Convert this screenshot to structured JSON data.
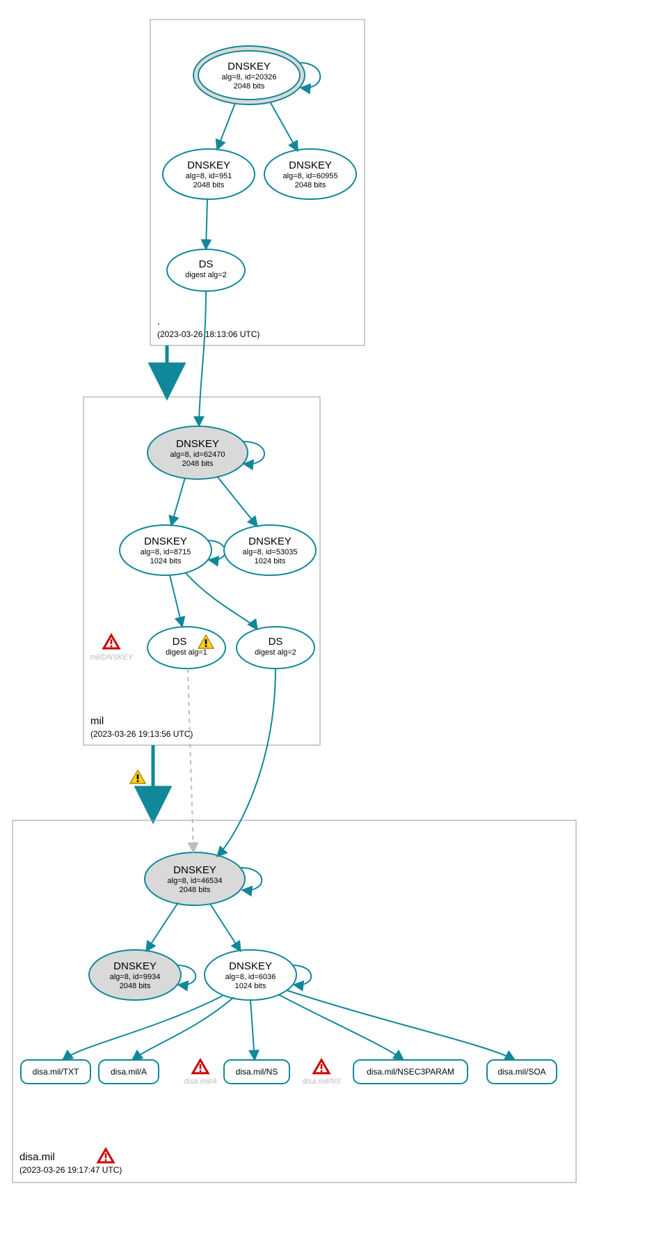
{
  "colors": {
    "stroke": "#118899",
    "ksk_fill": "#d9d9d9"
  },
  "zones": {
    "root": {
      "label": ".",
      "timestamp": "(2023-03-26 18:13:06 UTC)"
    },
    "mil": {
      "label": "mil",
      "timestamp": "(2023-03-26 19:13:56 UTC)"
    },
    "disa": {
      "label": "disa.mil",
      "timestamp": "(2023-03-26 19:17:47 UTC)"
    }
  },
  "nodes": {
    "root_ksk": {
      "title": "DNSKEY",
      "line2": "alg=8, id=20326",
      "line3": "2048 bits"
    },
    "root_zsk1": {
      "title": "DNSKEY",
      "line2": "alg=8, id=951",
      "line3": "2048 bits"
    },
    "root_zsk2": {
      "title": "DNSKEY",
      "line2": "alg=8, id=60955",
      "line3": "2048 bits"
    },
    "root_ds": {
      "title": "DS",
      "line2": "digest alg=2"
    },
    "mil_ksk": {
      "title": "DNSKEY",
      "line2": "alg=8, id=62470",
      "line3": "2048 bits"
    },
    "mil_zsk1": {
      "title": "DNSKEY",
      "line2": "alg=8, id=8715",
      "line3": "1024 bits"
    },
    "mil_zsk2": {
      "title": "DNSKEY",
      "line2": "alg=8, id=53035",
      "line3": "1024 bits"
    },
    "mil_ds1": {
      "title": "DS",
      "line2": "digest alg=1"
    },
    "mil_ds2": {
      "title": "DS",
      "line2": "digest alg=2"
    },
    "mil_err": {
      "label": "mil/DNSKEY"
    },
    "disa_ksk": {
      "title": "DNSKEY",
      "line2": "alg=8, id=46534",
      "line3": "2048 bits"
    },
    "disa_key2": {
      "title": "DNSKEY",
      "line2": "alg=8, id=9934",
      "line3": "2048 bits"
    },
    "disa_key3": {
      "title": "DNSKEY",
      "line2": "alg=8, id=6036",
      "line3": "1024 bits"
    },
    "rr_txt": {
      "label": "disa.mil/TXT"
    },
    "rr_a": {
      "label": "disa.mil/A"
    },
    "rr_ns": {
      "label": "disa.mil/NS"
    },
    "rr_nsec3": {
      "label": "disa.mil/NSEC3PARAM"
    },
    "rr_soa": {
      "label": "disa.mil/SOA"
    },
    "err_a": {
      "label": "disa.mil/A"
    },
    "err_ns": {
      "label": "disa.mil/NS"
    }
  },
  "edge_warn_label": ""
}
